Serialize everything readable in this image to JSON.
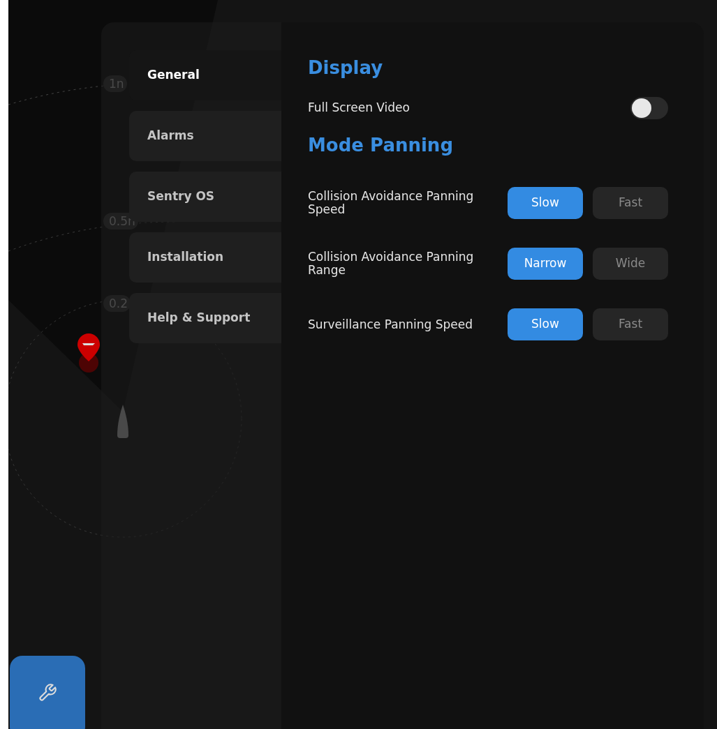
{
  "map": {
    "range_labels": [
      "1n",
      "0.5n",
      "0.2"
    ]
  },
  "nav": [
    {
      "label": "General",
      "selected": true
    },
    {
      "label": "Alarms",
      "selected": false
    },
    {
      "label": "Sentry OS",
      "selected": false
    },
    {
      "label": "Installation",
      "selected": false
    },
    {
      "label": "Help & Support",
      "selected": false
    }
  ],
  "sections": [
    {
      "title": "Display",
      "rows": [
        {
          "kind": "toggle",
          "label": "Full Screen Video",
          "on": false
        }
      ]
    },
    {
      "title": "Mode Panning",
      "rows": [
        {
          "kind": "choice",
          "label": "Collision Avoidance Panning Speed",
          "options": [
            {
              "label": "Slow",
              "selected": true
            },
            {
              "label": "Fast",
              "selected": false
            }
          ]
        },
        {
          "kind": "choice",
          "label": "Collision Avoidance Panning Range",
          "options": [
            {
              "label": "Narrow",
              "selected": true
            },
            {
              "label": "Wide",
              "selected": false
            }
          ]
        },
        {
          "kind": "choice",
          "label": "Surveillance Panning Speed",
          "options": [
            {
              "label": "Slow",
              "selected": true
            },
            {
              "label": "Fast",
              "selected": false
            }
          ]
        }
      ]
    }
  ]
}
